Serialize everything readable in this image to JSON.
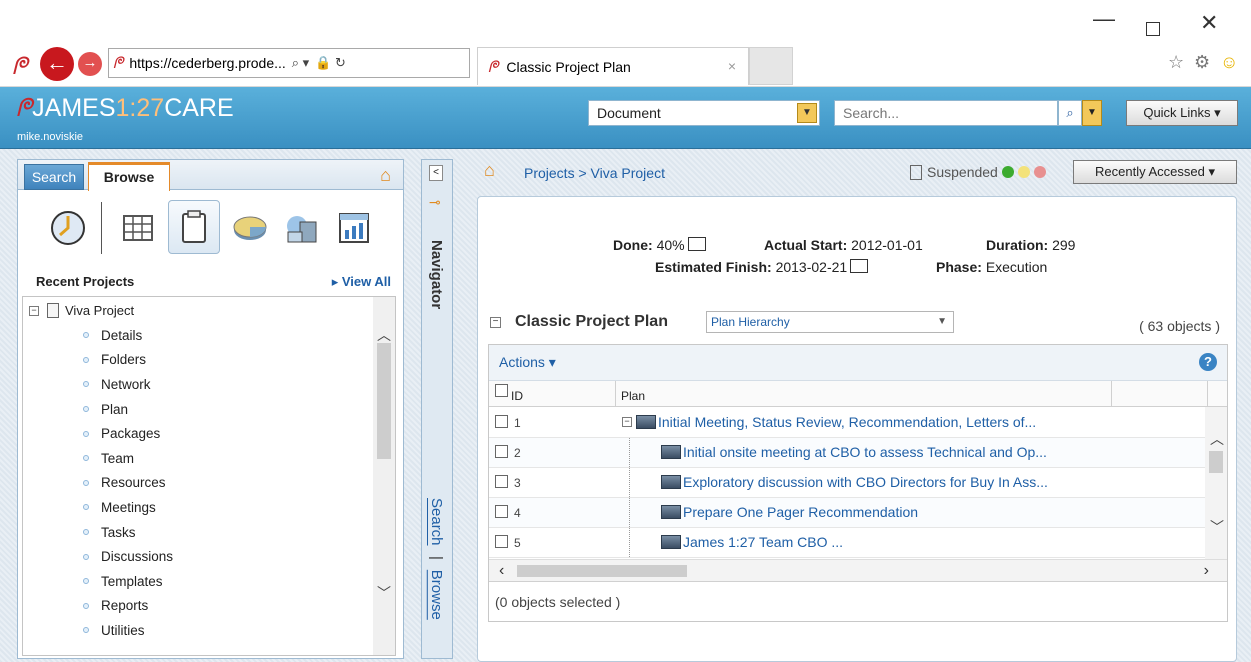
{
  "browser": {
    "url": "https://cederberg.prode...",
    "tab_title": "Classic Project Plan",
    "tab_close": "×",
    "back": "←",
    "forward": "→",
    "minimize": "—",
    "close": "✕",
    "search_glyph": "⌕ ▾",
    "lock_glyph": "🔒 ↻",
    "star": "☆",
    "gear": "⚙",
    "smile": "☺"
  },
  "header": {
    "brand_mark": "ᖘ",
    "brand_a": "JAMES",
    "brand_b": "1:27",
    "brand_c": "CARE",
    "user": "mike.noviskie",
    "doc_select": "Document",
    "search_placeholder": "Search...",
    "quick_links": "Quick Links ▾",
    "caret": "▼",
    "search_icon": "⌕"
  },
  "left_panel": {
    "tab_search": "Search",
    "tab_browse": "Browse",
    "recent_projects": "Recent Projects",
    "view_all": "▸ View All",
    "root": "Viva Project",
    "items": [
      "Details",
      "Folders",
      "Network",
      "Plan",
      "Packages",
      "Team",
      "Resources",
      "Meetings",
      "Tasks",
      "Discussions",
      "Templates",
      "Reports",
      "Utilities"
    ]
  },
  "navigator": {
    "title": "Navigator",
    "collapse": "<",
    "link_search": "Search",
    "sep": "|",
    "link_browse": "Browse"
  },
  "breadcrumb": {
    "path": "Projects > Viva Project",
    "status": "Suspended",
    "recent": "Recently Accessed ▾",
    "lights": [
      "#3cab2f",
      "#f3e27a",
      "#e89090"
    ]
  },
  "summary": {
    "done_label": "Done:",
    "done_value": "40%",
    "start_label": "Actual Start:",
    "start_value": "2012-01-01",
    "duration_label": "Duration:",
    "duration_value": "299",
    "finish_label": "Estimated Finish:",
    "finish_value": "2013-02-21",
    "phase_label": "Phase:",
    "phase_value": "Execution"
  },
  "plan": {
    "title": "Classic Project Plan",
    "view": "Plan Hierarchy",
    "count": "( 63 objects )",
    "actions": "Actions ▾",
    "help": "?",
    "col_id": "ID",
    "col_plan": "Plan",
    "rows": [
      {
        "id": "1",
        "text": "Initial Meeting, Status Review, Recommendation, Letters of..."
      },
      {
        "id": "2",
        "text": "Initial onsite meeting at CBO to assess Technical and Op..."
      },
      {
        "id": "3",
        "text": "Exploratory discussion with CBO Directors for Buy In Ass..."
      },
      {
        "id": "4",
        "text": "Prepare One Pager Recommendation"
      },
      {
        "id": "5",
        "text": "James 1:27 Team CBO ..."
      }
    ],
    "selected": "(0 objects selected )"
  }
}
